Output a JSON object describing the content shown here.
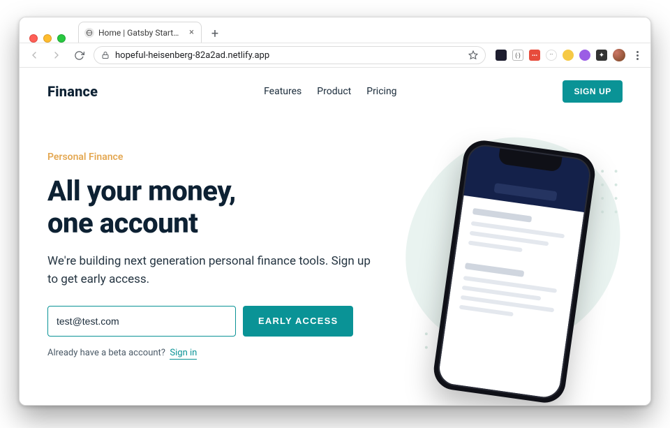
{
  "browser": {
    "tab_title": "Home | Gatsby Starter SaaS M",
    "url": "hopeful-heisenberg-82a2ad.netlify.app",
    "new_tab_glyph": "+",
    "close_glyph": "×"
  },
  "header": {
    "logo": "Finance",
    "nav": [
      "Features",
      "Product",
      "Pricing"
    ],
    "signup_label": "SIGN UP"
  },
  "hero": {
    "eyebrow": "Personal Finance",
    "headline_line1": "All your money,",
    "headline_line2": "one account",
    "subhead": "We're building next generation personal finance tools. Sign up to get early access.",
    "email_value": "test@test.com",
    "cta_label": "EARLY ACCESS",
    "beta_prompt": "Already have a beta account?",
    "beta_link": "Sign in"
  },
  "colors": {
    "accent": "#0a9396",
    "ink": "#0d2133",
    "eyebrow": "#e4a853"
  }
}
